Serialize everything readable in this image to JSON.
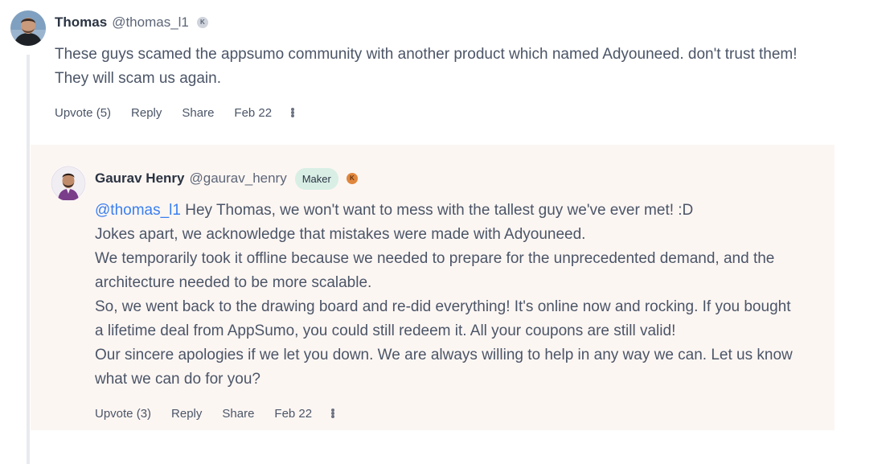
{
  "comment": {
    "author_name": "Thomas",
    "author_handle": "@thomas_l1",
    "karma_badge": "K",
    "text": "These guys scamed the appsumo community with another product which named Adyouneed. don't trust them! They will scam us again.",
    "actions": {
      "upvote": "Upvote (5)",
      "reply": "Reply",
      "share": "Share",
      "date": "Feb 22"
    }
  },
  "reply": {
    "author_name": "Gaurav Henry",
    "author_handle": "@gaurav_henry",
    "maker_badge": "Maker",
    "karma_badge": "K",
    "mention": "@thomas_l1",
    "lines": {
      "l1_rest": " Hey Thomas, we won't want to mess with the tallest guy we've ever met! :D",
      "l2": "Jokes apart, we acknowledge that mistakes were made with Adyouneed.",
      "l3": "We temporarily took it offline because we needed to prepare for the unprecedented demand, and the architecture needed to be more scalable.",
      "l4": "So, we went back to the drawing board and re-did everything! It's online now and rocking. If you bought a lifetime deal from AppSumo, you could still redeem it. All your coupons are still valid!",
      "l5": "Our sincere apologies if we let you down. We are always willing to help in any way we can. Let us know what we can do for you?"
    },
    "actions": {
      "upvote": "Upvote (3)",
      "reply": "Reply",
      "share": "Share",
      "date": "Feb 22"
    }
  },
  "colors": {
    "mention": "#3a7ff0",
    "reply_background": "#fcf6f3",
    "maker_badge": "#d9efe6",
    "karma_orange": "#e0873d"
  },
  "icons": {
    "more": "more-horizontal-icon"
  }
}
